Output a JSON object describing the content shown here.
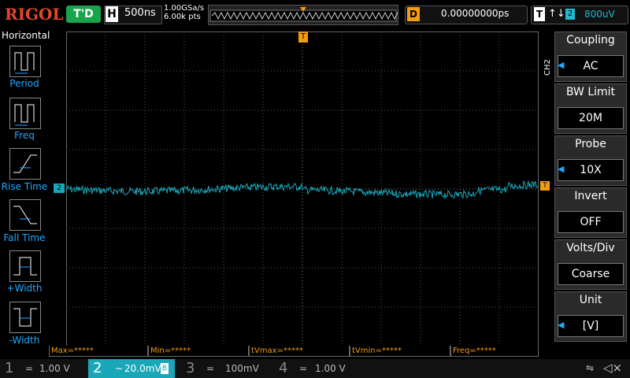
{
  "top": {
    "logo": "RIGOL",
    "run_state": "T'D",
    "timebase_label": "H",
    "timebase_value": "500ns",
    "sample_rate": "1.00GSa/s",
    "points": "6.00k pts",
    "delay_label": "D",
    "delay_value": "0.00000000ps",
    "trigger_label": "T",
    "trigger_edge": "↑↓",
    "trigger_source": "2",
    "trigger_level": "800uV"
  },
  "left": {
    "title": "Horizontal",
    "items": [
      "Period",
      "Freq",
      "Rise Time",
      "Fall Time",
      "+Width",
      "-Width"
    ]
  },
  "right": {
    "channel_tag": "CH2",
    "items": [
      {
        "label": "Coupling",
        "value": "AC"
      },
      {
        "label": "BW Limit",
        "value": "20M"
      },
      {
        "label": "Probe",
        "value": "10X"
      },
      {
        "label": "Invert",
        "value": "OFF"
      },
      {
        "label": "Volts/Div",
        "value": "Coarse"
      },
      {
        "label": "Unit",
        "value": "[V]"
      }
    ]
  },
  "measure": {
    "max": "Max=*****",
    "min": "Min=*****",
    "tvmax": "tVmax=*****",
    "tvmin": "tVmin=*****",
    "freq": "Freq=*****"
  },
  "bottom": {
    "ch1": {
      "num": "1",
      "coupling": "=",
      "scale": "1.00 V"
    },
    "ch2": {
      "num": "2",
      "coupling": "~",
      "scale": "20.0mV",
      "bw": "B"
    },
    "ch3": {
      "num": "3",
      "coupling": "=",
      "scale": "100mV"
    },
    "ch4": {
      "num": "4",
      "coupling": "=",
      "scale": "1.00 V"
    }
  },
  "marker": {
    "ch2": "2",
    "trigger_top": "T",
    "trigger_right": "T"
  },
  "colors": {
    "ch2": "#1aa7b8",
    "trigger": "#f39c12",
    "brand": "#e8462b"
  }
}
